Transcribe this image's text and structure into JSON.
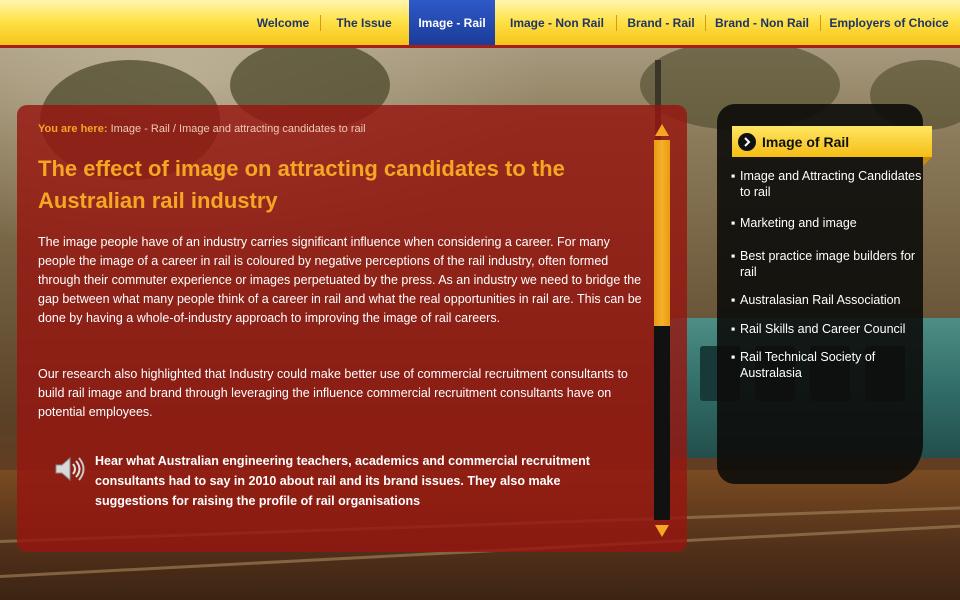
{
  "nav": {
    "items": [
      {
        "label": "Welcome"
      },
      {
        "label": "The Issue"
      },
      {
        "label": "Image - Rail"
      },
      {
        "label": "Image - Non Rail"
      },
      {
        "label": "Brand - Rail"
      },
      {
        "label": "Brand - Non Rail"
      },
      {
        "label": "Employers of Choice"
      }
    ],
    "active_index": 2
  },
  "breadcrumb": {
    "prefix": "You are here:",
    "path": "Image - Rail / Image and attracting candidates to rail"
  },
  "content": {
    "title": "The effect of image on attracting candidates to the Australian rail industry",
    "paragraphs": [
      "The image people have of an industry carries significant influence when considering a career. For many people the image of a career in rail is coloured by negative perceptions of the rail industry, often formed through their commuter experience or images perpetuated by the press. As an industry we need to bridge the gap between what many people think of a career in rail and what the real opportunities in rail are. This can be done by having a whole-of-industry approach to improving the image of rail careers.",
      "Our research also highlighted that Industry could make better use of commercial recruitment consultants to build rail image and brand through leveraging the influence commercial recruitment consultants have on potential employees."
    ],
    "callout": "Hear what Australian engineering teachers, academics and commercial recruitment consultants had to say in 2010 about rail and its brand issues. They also make suggestions for raising the profile of rail organisations",
    "callout_icon": "speaker-icon"
  },
  "scrollbar": {
    "position_fraction": 0.0,
    "visible_fraction": 0.49
  },
  "sidebar": {
    "title": "Image of Rail",
    "title_icon": "chevron-right-circle-icon",
    "bullet": "▪",
    "items": [
      {
        "label": "Image and Attracting Candidates to rail"
      },
      {
        "label": "Marketing and image"
      },
      {
        "label": "Best practice image builders for rail"
      },
      {
        "label": "Australasian Rail Association"
      },
      {
        "label": "Rail Skills and Career Council"
      },
      {
        "label": "Rail Technical Society of Australasia"
      }
    ]
  },
  "colors": {
    "nav_bg": "#ffe24a",
    "nav_text": "#1f3567",
    "nav_active": "#1b3b98",
    "panel_red": "#96160f",
    "accent_orange": "#f5a623",
    "sidebar_bg": "#0c0c0a"
  }
}
